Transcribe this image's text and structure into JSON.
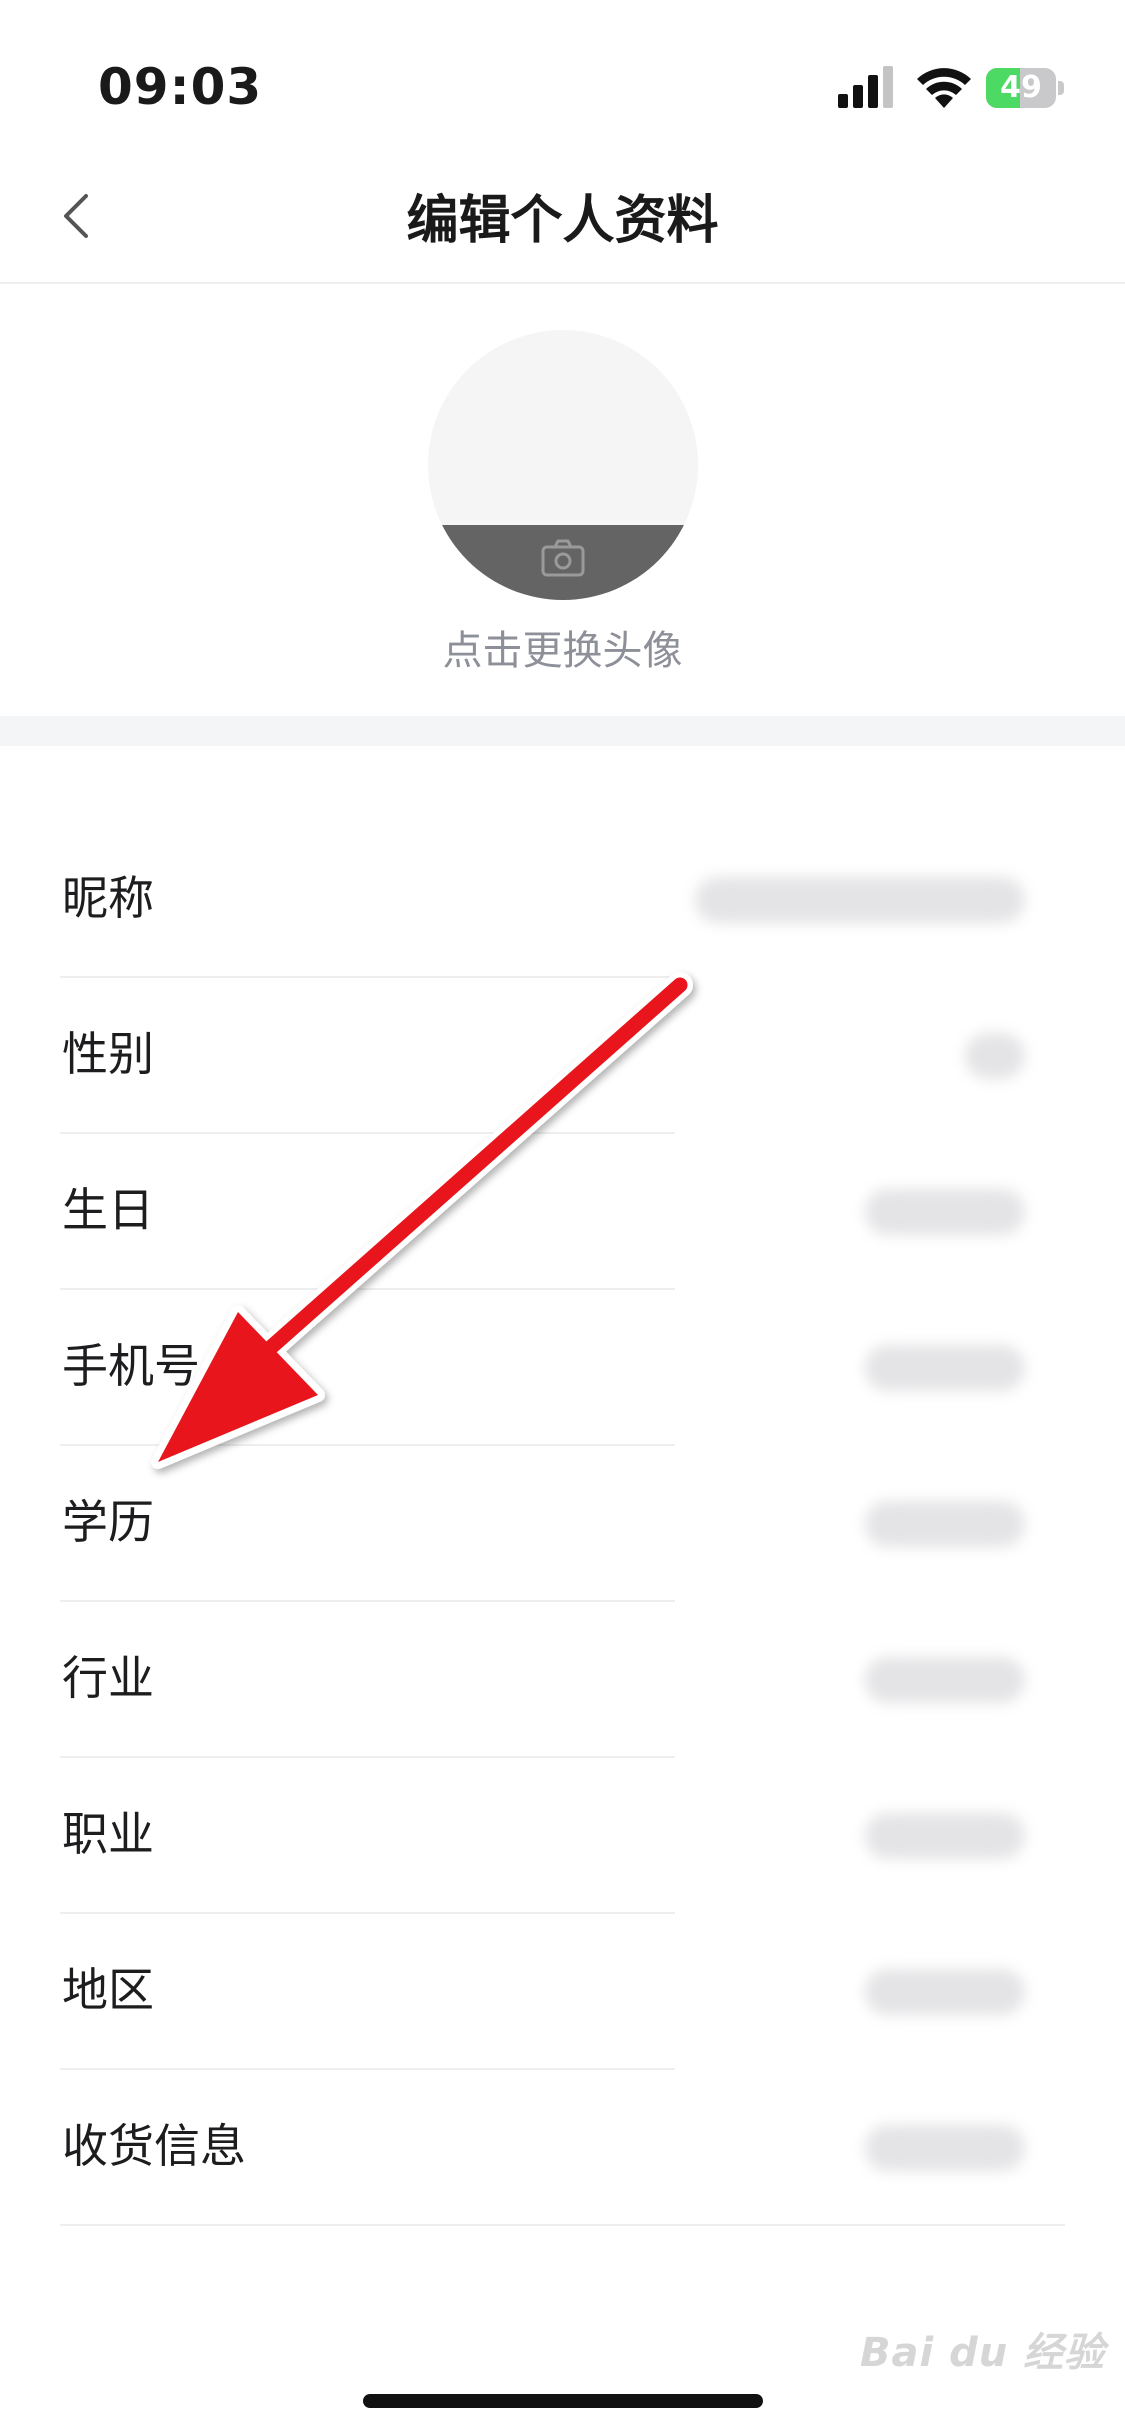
{
  "status_bar": {
    "time": "09:03",
    "battery": "49",
    "battery_level": 0.49
  },
  "nav": {
    "title": "编辑个人资料"
  },
  "avatar": {
    "hint": "点击更换头像"
  },
  "profile_rows": [
    {
      "label": "昵称"
    },
    {
      "label": "性别"
    },
    {
      "label": "生日"
    },
    {
      "label": "手机号"
    },
    {
      "label": "学历"
    },
    {
      "label": "行业"
    },
    {
      "label": "职业"
    },
    {
      "label": "地区"
    },
    {
      "label": "收货信息"
    }
  ],
  "watermark": "Bai du 经验",
  "colors": {
    "annotation_arrow": "#e8141b",
    "battery_green": "#4cd964",
    "hint_gray": "#8e9099"
  }
}
